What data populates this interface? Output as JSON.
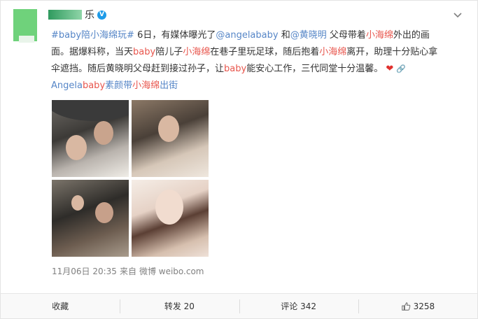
{
  "post": {
    "username": "乐",
    "verified_mark": "V",
    "content": {
      "line1": [
        {
          "t": "topic",
          "v": "#baby陪小海绵玩#"
        },
        {
          "t": "text",
          "v": " 6日，有媒体曝光了"
        },
        {
          "t": "mention",
          "v": "@angelababy"
        },
        {
          "t": "text",
          "v": " 和"
        },
        {
          "t": "mention",
          "v": "@黄晓明"
        },
        {
          "t": "text",
          "v": " 父母带着"
        },
        {
          "t": "hl",
          "v": "小海绵"
        },
        {
          "t": "text",
          "v": "外出的画"
        }
      ],
      "line2": [
        {
          "t": "text",
          "v": "面。据爆料称，当天"
        },
        {
          "t": "hl",
          "v": "baby"
        },
        {
          "t": "text",
          "v": "陪儿子"
        },
        {
          "t": "hl",
          "v": "小海绵"
        },
        {
          "t": "text",
          "v": "在巷子里玩足球，随后抱着"
        },
        {
          "t": "hl",
          "v": "小海绵"
        },
        {
          "t": "text",
          "v": "离开，助理十分贴心拿"
        }
      ],
      "line3": [
        {
          "t": "text",
          "v": "伞遮挡。随后黄晓明父母赶到接过孙子，让"
        },
        {
          "t": "hl",
          "v": "baby"
        },
        {
          "t": "text",
          "v": "能安心工作，三代同堂十分温馨。"
        }
      ],
      "link_text": [
        {
          "t": "topic",
          "v": "Angela"
        },
        {
          "t": "hl",
          "v": "baby"
        },
        {
          "t": "topic",
          "v": "素颜带"
        },
        {
          "t": "hl",
          "v": "小海绵"
        },
        {
          "t": "topic",
          "v": "出街"
        }
      ],
      "heart_icon": "heart-icon",
      "link_icon": "link-icon"
    },
    "meta": {
      "date": "11月06日 20:35",
      "source_prefix": "来自",
      "source": "微博 weibo.com"
    },
    "footer": {
      "favorite": "收藏",
      "repost": "转发 20",
      "comment": "评论 342",
      "likes": "3258"
    }
  },
  "colors": {
    "link": "#5686c7",
    "highlight": "#e8564d",
    "verified": "#1e9be8"
  }
}
